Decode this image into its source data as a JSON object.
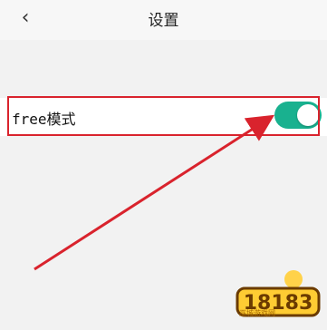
{
  "header": {
    "back_icon": "chevron-left-icon",
    "title": "设置"
  },
  "settings": {
    "free_mode": {
      "label": "free模式",
      "enabled": true,
      "accent_color": "#19b18f"
    }
  },
  "annotation": {
    "box_color": "#d9232d",
    "arrow_color": "#d9232d"
  },
  "watermark": {
    "logo_text": "18183",
    "sub_text": "巫城游戏网"
  }
}
